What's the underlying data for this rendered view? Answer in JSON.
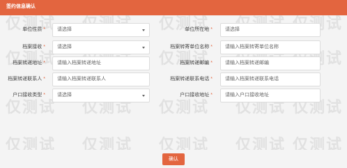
{
  "header": {
    "title": "签约信息确认"
  },
  "watermark": {
    "text": "仅测试"
  },
  "form": {
    "rows": [
      {
        "left": {
          "label": "单位性质",
          "required": true,
          "value": "请选择",
          "select": true
        },
        "right": {
          "label": "单位所在地",
          "required": true,
          "value": "请选择",
          "select": true
        }
      },
      {
        "left": {
          "label": "档案接收",
          "required": true,
          "value": "请选择",
          "select": true
        },
        "right": {
          "label": "档案转寄单位名称",
          "required": true,
          "value": "请输入档案转寄单位名称",
          "select": false
        }
      },
      {
        "left": {
          "label": "档案转递地址",
          "required": true,
          "value": "请输入档案转递地址",
          "select": false
        },
        "right": {
          "label": "档案转递邮编",
          "required": true,
          "value": "请输入档案转递邮编",
          "select": false
        }
      },
      {
        "left": {
          "label": "档案转递联系人",
          "required": true,
          "value": "请输入档案转递联系人",
          "select": false
        },
        "right": {
          "label": "档案转递联系电话",
          "required": true,
          "value": "请输入档案转递联系电话",
          "select": false
        }
      },
      {
        "left": {
          "label": "户口接收类型",
          "required": true,
          "value": "请选择",
          "select": true
        },
        "right": {
          "label": "户口接收地址",
          "required": true,
          "value": "请输入户口接收地址",
          "select": false
        }
      }
    ]
  },
  "footer": {
    "confirm_label": "确认"
  },
  "colors": {
    "accent": "#e3653f",
    "background": "#f4f4f4"
  }
}
